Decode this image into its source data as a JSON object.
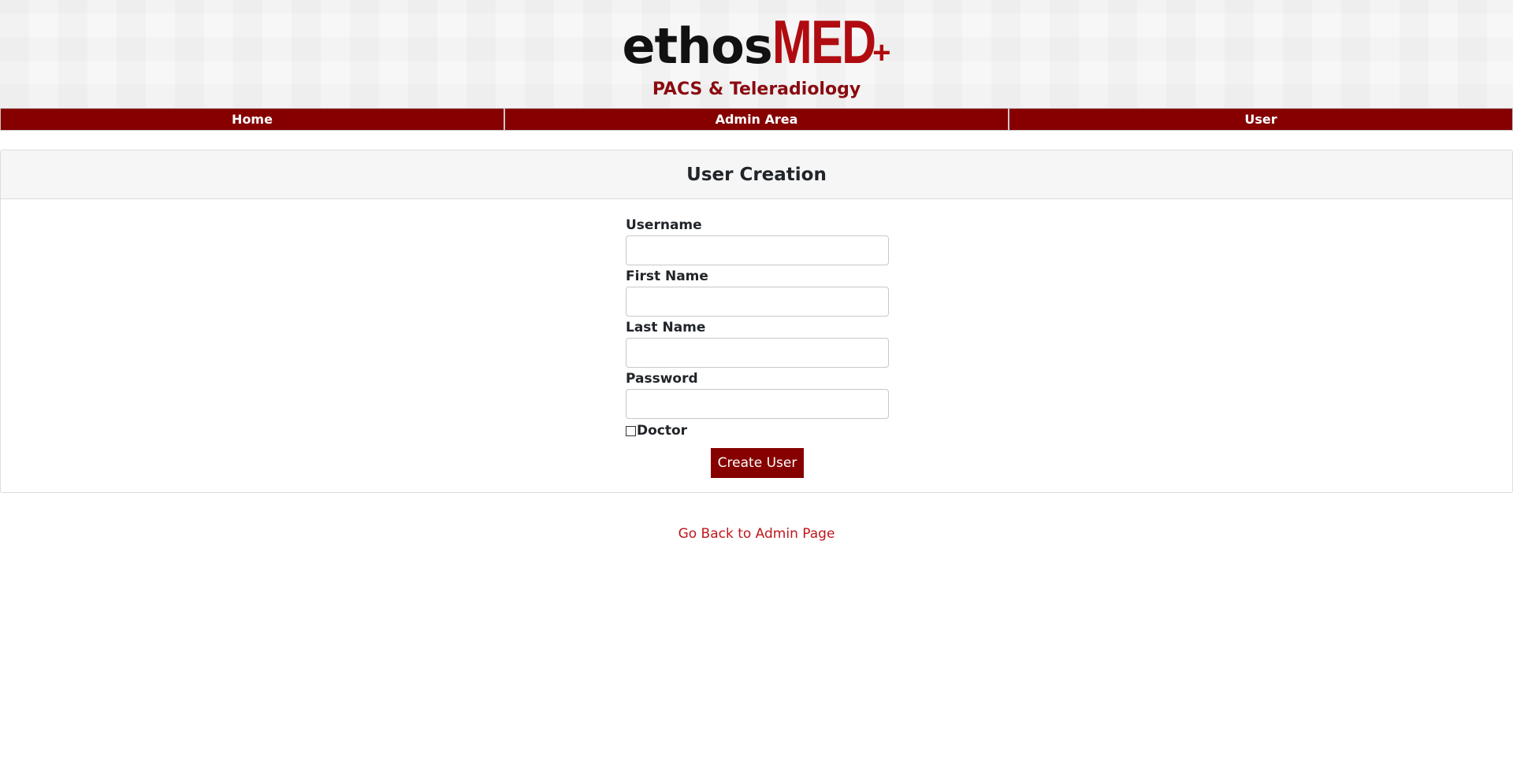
{
  "logo": {
    "ethos": "ethos",
    "med": "MED",
    "plus": "+",
    "subtitle": "PACS & Teleradiology"
  },
  "nav": {
    "home": "Home",
    "admin_area": "Admin Area",
    "user": "User"
  },
  "card": {
    "title": "User Creation"
  },
  "form": {
    "username_label": "Username",
    "username_value": "",
    "first_name_label": "First Name",
    "first_name_value": "",
    "last_name_label": "Last Name",
    "last_name_value": "",
    "password_label": "Password",
    "password_value": "",
    "doctor_label": "Doctor",
    "doctor_checked": false,
    "submit_label": "Create User"
  },
  "links": {
    "back_to_admin": "Go Back to Admin Page"
  },
  "colors": {
    "brand_red": "#860000",
    "logo_red": "#b00b10",
    "link_red": "#c0161b"
  }
}
